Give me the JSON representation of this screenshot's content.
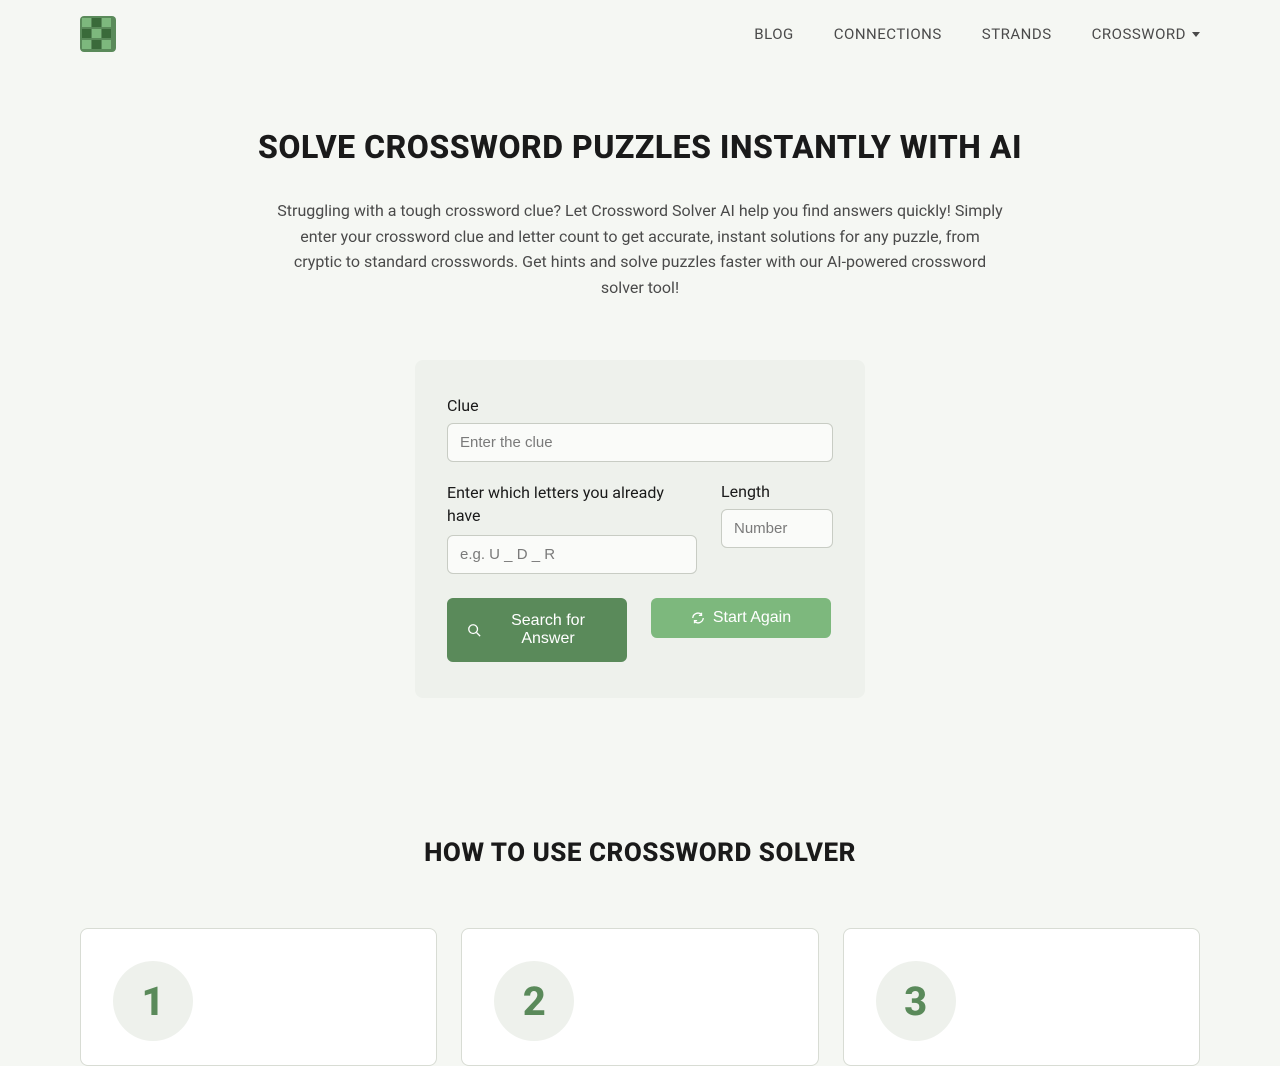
{
  "nav": {
    "blog": "BLOG",
    "connections": "CONNECTIONS",
    "strands": "STRANDS",
    "crossword": "CROSSWORD"
  },
  "hero": {
    "title": "SOLVE CROSSWORD PUZZLES INSTANTLY WITH AI",
    "description": "Struggling with a tough crossword clue? Let Crossword Solver AI help you find answers quickly! Simply enter your crossword clue and letter count to get accurate, instant solutions for any puzzle, from cryptic to standard crosswords. Get hints and solve puzzles faster with our AI-powered crossword solver tool!"
  },
  "solver": {
    "clue_label": "Clue",
    "clue_placeholder": "Enter the clue",
    "letters_label": "Enter which letters you already have",
    "letters_placeholder": "e.g. U _ D _ R",
    "length_label": "Length",
    "length_placeholder": "Number",
    "search_button": "Search for Answer",
    "reset_button": "Start Again"
  },
  "how_to": {
    "title": "HOW TO USE CROSSWORD SOLVER",
    "steps": [
      {
        "number": "1"
      },
      {
        "number": "2"
      },
      {
        "number": "3"
      }
    ]
  }
}
